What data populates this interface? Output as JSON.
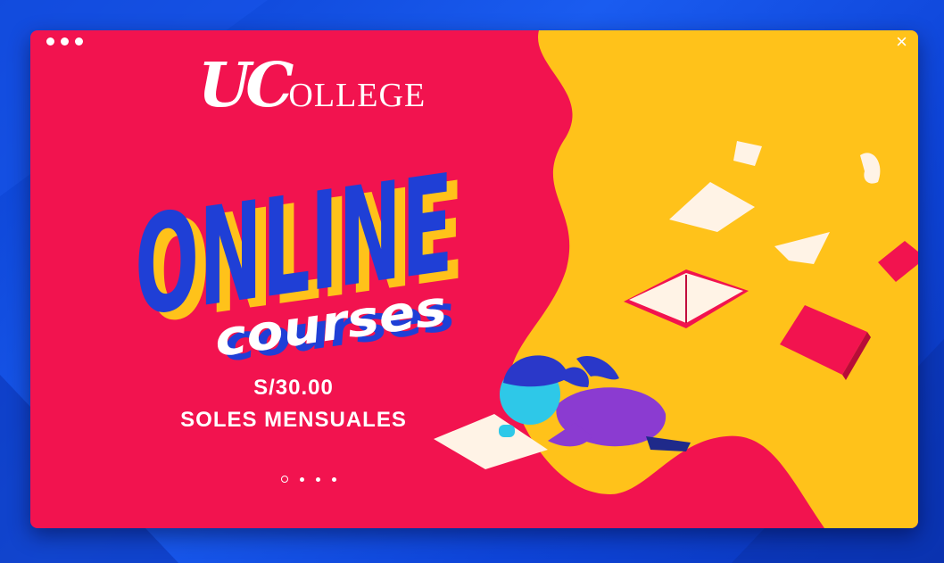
{
  "window": {
    "close_label": "×"
  },
  "brand": {
    "initials": "UC",
    "rest": "OLLEGE"
  },
  "headline": {
    "line1": "ONLINE",
    "line2": "courses"
  },
  "price": {
    "amount": "S/30.00",
    "period": "SOLES MENSUALES"
  },
  "carousel": {
    "slides": 4,
    "active": 1
  },
  "colors": {
    "background": "#1248e0",
    "panel": "#f2134f",
    "accent": "#ffc400",
    "headline": "#1f3fd6"
  }
}
